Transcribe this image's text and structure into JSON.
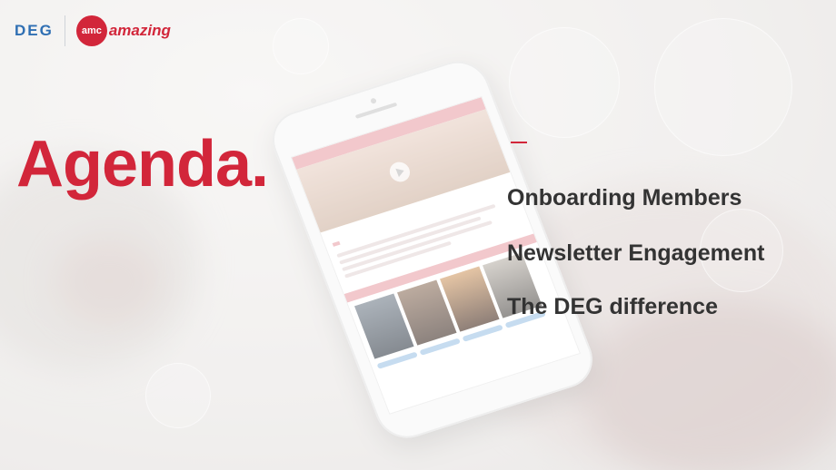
{
  "brand": {
    "deg_logo": "DEG",
    "amc_logo": "amc",
    "amc_tagline": "amazing"
  },
  "slide": {
    "title": "Agenda.",
    "items": [
      "Onboarding Members",
      "Newsletter Engagement",
      "The DEG difference"
    ]
  },
  "colors": {
    "accent": "#d2263a",
    "deg_blue": "#2f6fb3",
    "text": "#333333"
  }
}
